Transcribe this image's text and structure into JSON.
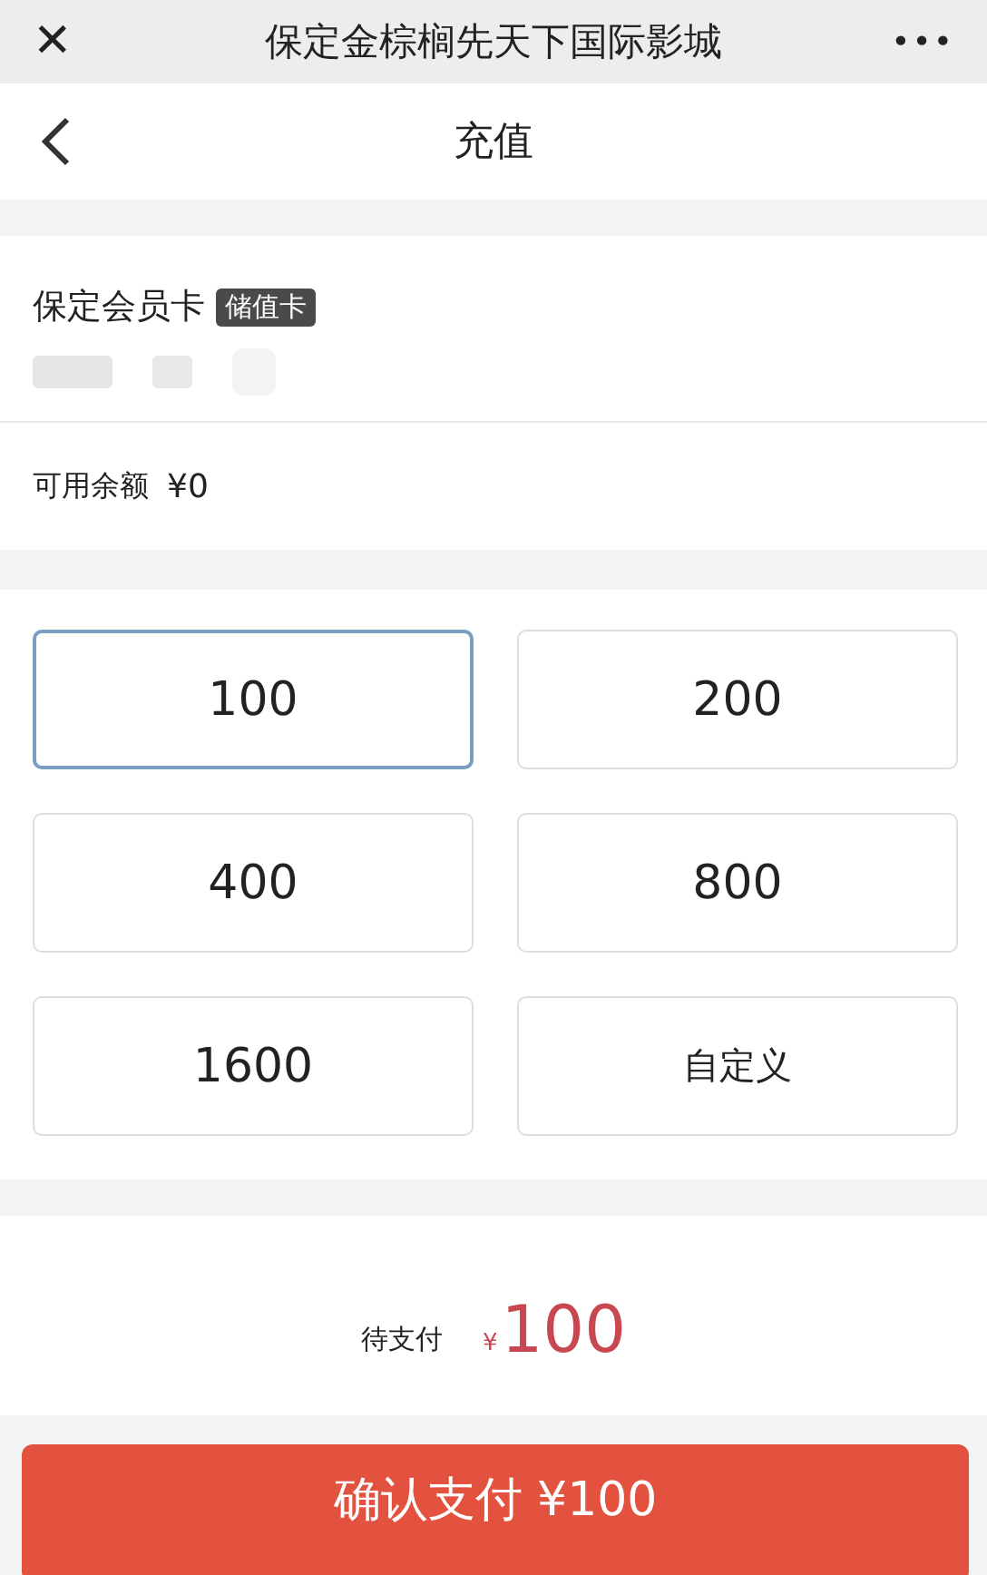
{
  "window": {
    "title": "保定金棕榈先天下国际影城",
    "close": "✕",
    "more": "•••"
  },
  "header": {
    "title": "充值"
  },
  "card": {
    "name": "保定会员卡",
    "tag": "储值卡",
    "balance_label": "可用余额",
    "balance": "¥0"
  },
  "options": [
    {
      "label": "100",
      "kind": "amount",
      "selected": true
    },
    {
      "label": "200",
      "kind": "amount",
      "selected": false
    },
    {
      "label": "400",
      "kind": "amount",
      "selected": false
    },
    {
      "label": "800",
      "kind": "amount",
      "selected": false
    },
    {
      "label": "1600",
      "kind": "amount",
      "selected": false
    },
    {
      "label": "自定义",
      "kind": "custom",
      "selected": false
    }
  ],
  "payment": {
    "label": "待支付",
    "currency": "¥",
    "amount": "100"
  },
  "confirm_button": "确认支付 ¥100"
}
